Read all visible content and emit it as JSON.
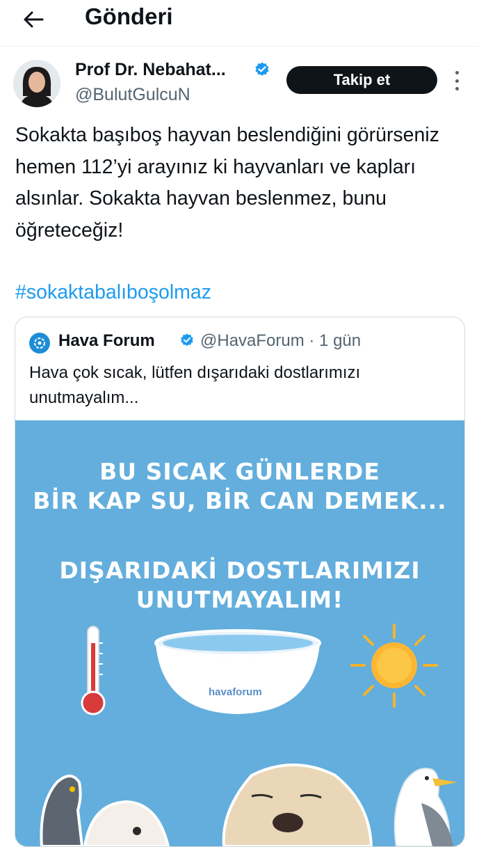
{
  "header": {
    "title": "Gönderi",
    "back_icon": "arrow-left-icon"
  },
  "post": {
    "author_name": "Prof Dr. Nebahat...",
    "author_handle": "@BulutGulcuN",
    "follow_label": "Takip et",
    "text": "Sokakta başıboş hayvan beslendiğini görürseniz hemen 112’yi arayınız ki hayvanları ve kapları alsınlar. Sokakta hayvan beslenmez, bunu öğreteceğiz!",
    "hashtag": "#sokaktabalıboşolmaz"
  },
  "quote": {
    "name": "Hava Forum",
    "handle_time": "@HavaForum · 1 gün",
    "text": "Hava çok sıcak, lütfen dışarıdaki dostlarımızı unutmayalım...",
    "image": {
      "line1": "BU SICAK GÜNLERDE",
      "line2": "BİR KAP SU, BİR CAN DEMEK...",
      "line3": "DIŞARIDAKİ DOSTLARIMIZI",
      "line4": "UNUTMAYALIM!",
      "bowl_label": "havaforum"
    }
  },
  "colors": {
    "accent": "#1d9bf0",
    "verified": "#1d9bf0",
    "media_bg": "#63aedd",
    "follow_bg": "#0f1419"
  }
}
